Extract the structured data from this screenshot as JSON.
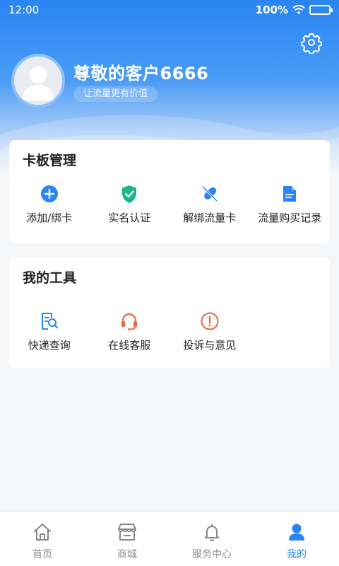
{
  "status_bar": {
    "time": "12:00",
    "battery": "100%"
  },
  "profile": {
    "name": "尊敬的客户6666",
    "slogan": "让流量更有价值"
  },
  "card_management": {
    "title": "卡板管理",
    "items": [
      {
        "label": "添加/绑卡",
        "icon": "add-circle-icon"
      },
      {
        "label": "实名认证",
        "icon": "shield-check-icon"
      },
      {
        "label": "解绑流量卡",
        "icon": "unbind-icon"
      },
      {
        "label": "流量购买记录",
        "icon": "document-icon"
      }
    ]
  },
  "tools": {
    "title": "我的工具",
    "items": [
      {
        "label": "快递查询",
        "icon": "express-search-icon"
      },
      {
        "label": "在线客服",
        "icon": "headset-icon"
      },
      {
        "label": "投诉与意见",
        "icon": "exclamation-circle-icon"
      }
    ]
  },
  "bottom_nav": {
    "items": [
      {
        "label": "首页",
        "icon": "home-icon"
      },
      {
        "label": "商城",
        "icon": "store-icon"
      },
      {
        "label": "服务中心",
        "icon": "bell-icon"
      },
      {
        "label": "我的",
        "icon": "user-icon"
      }
    ],
    "active_index": 3
  },
  "colors": {
    "primary": "#2a85f2",
    "green": "#1fb58a",
    "orange": "#f0643c",
    "header_top": "#2a85f2"
  }
}
